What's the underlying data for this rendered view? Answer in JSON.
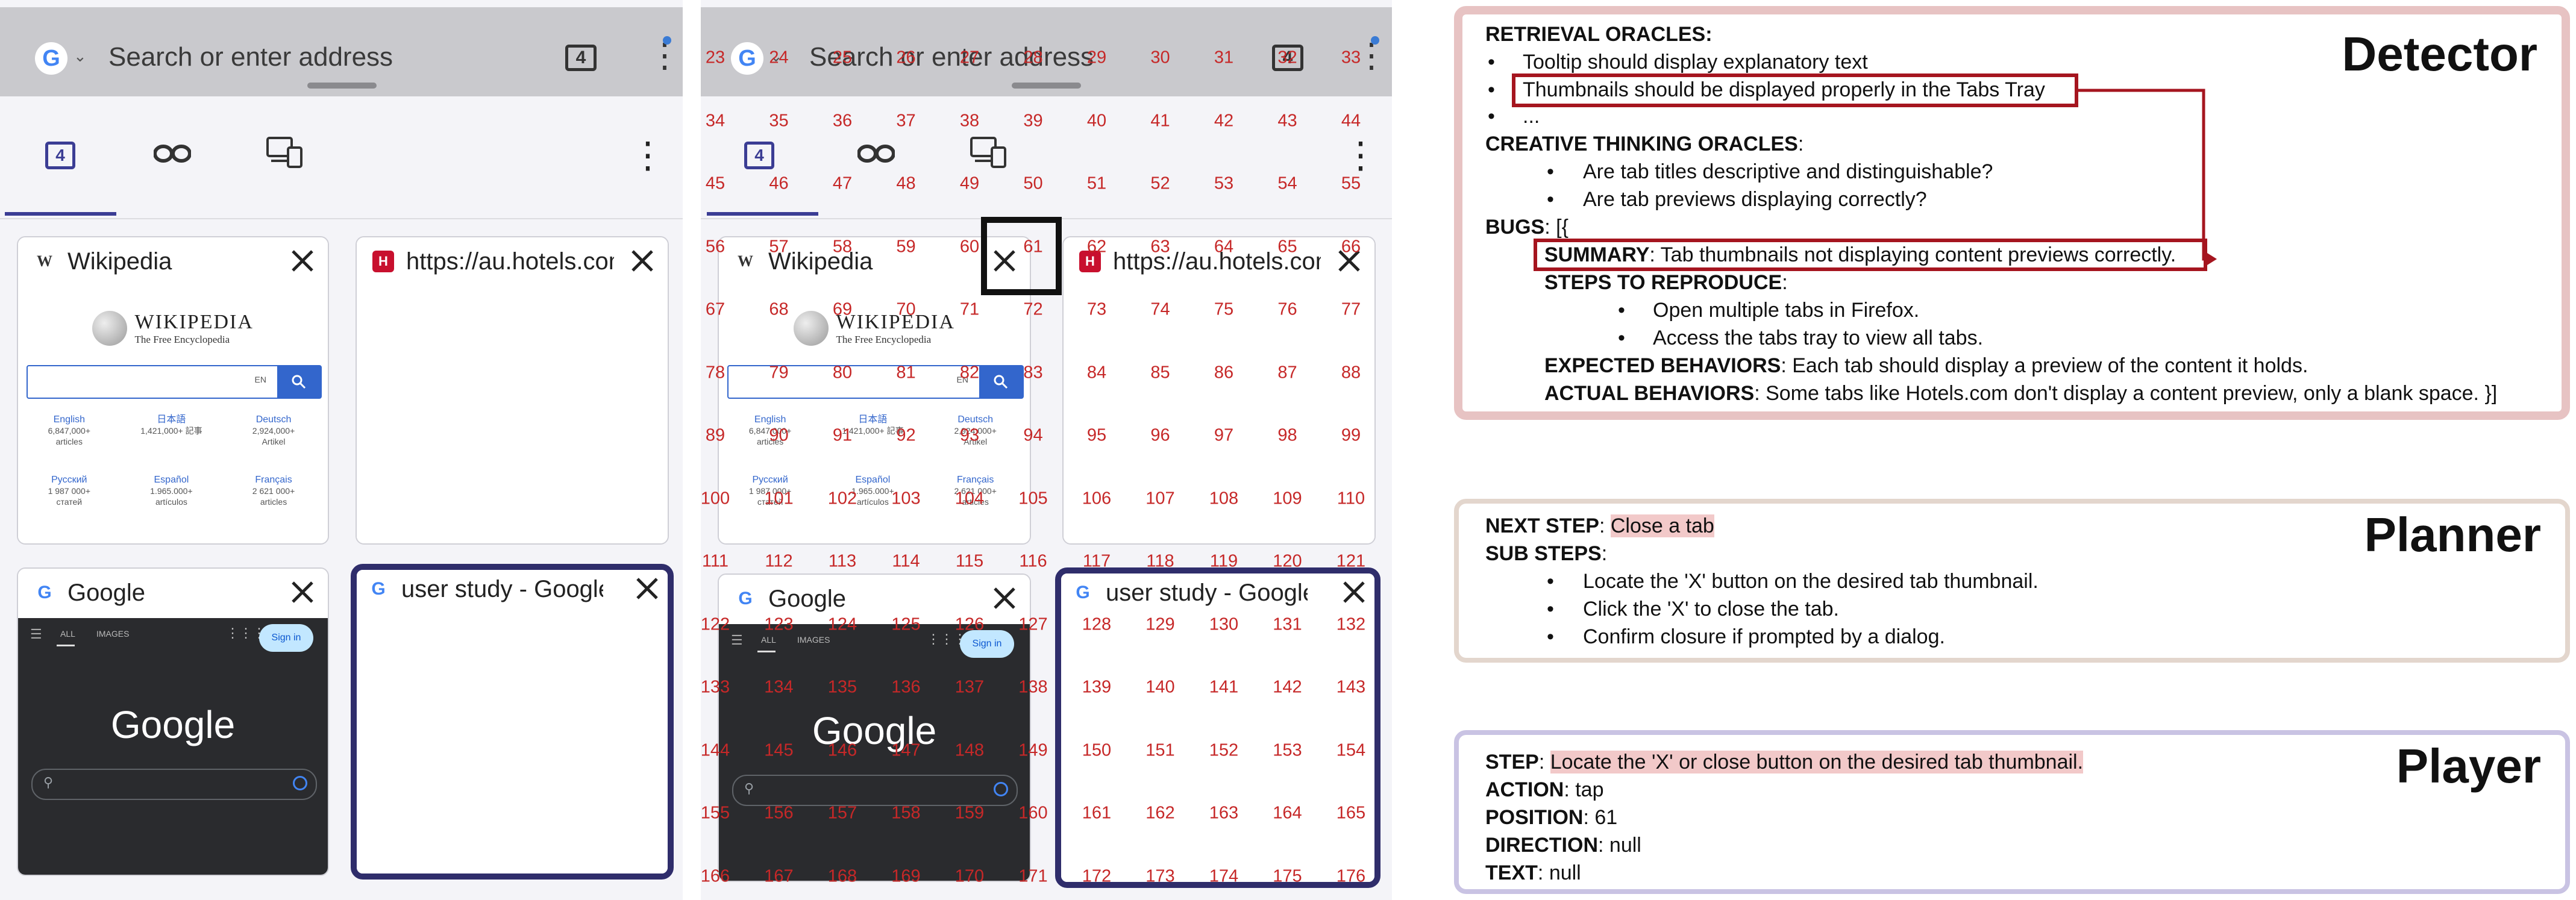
{
  "browser": {
    "address_placeholder": "Search or enter address",
    "tab_count": "4",
    "google_glyph": "G",
    "tabs": [
      {
        "title": "Wikipedia",
        "favicon": "W"
      },
      {
        "title": "https://au.hotels.com",
        "favicon": "H"
      },
      {
        "title": "Google",
        "favicon": "G"
      },
      {
        "title": "user study - Google S",
        "favicon": "G"
      }
    ],
    "wiki_thumb": {
      "brand": "WIKIPEDIA",
      "tagline": "The Free Encyclopedia",
      "lang_select": "EN",
      "languages": [
        {
          "name": "English",
          "count": "6,847,000+",
          "unit": "articles"
        },
        {
          "name": "日本語",
          "count": "1,421,000+ 記事",
          "unit": ""
        },
        {
          "name": "Deutsch",
          "count": "2,924,000+",
          "unit": "Artikel"
        },
        {
          "name": "Русский",
          "count": "1 987 000+",
          "unit": "статей"
        },
        {
          "name": "Español",
          "count": "1.965.000+",
          "unit": "artículos"
        },
        {
          "name": "Français",
          "count": "2 621 000+",
          "unit": "articles"
        }
      ]
    },
    "google_thumb": {
      "tab_all": "ALL",
      "tab_images": "IMAGES",
      "sign_in": "Sign in",
      "logo": "Google"
    }
  },
  "grid_labels": {
    "row_a": [
      "23",
      "24",
      "25",
      "26",
      "27",
      "28",
      "29",
      "30",
      "31",
      "32",
      "33"
    ],
    "row_b": [
      "34",
      "35",
      "36",
      "37",
      "38",
      "39",
      "40",
      "41",
      "42",
      "43",
      "44"
    ],
    "row_c": [
      "45",
      "46",
      "47",
      "48",
      "49",
      "50",
      "51",
      "52",
      "53",
      "54",
      "55"
    ],
    "row_d": [
      "56",
      "57",
      "58",
      "59",
      "60",
      "61",
      "62",
      "63",
      "64",
      "65",
      "66"
    ],
    "row_e": [
      "67",
      "68",
      "69",
      "70",
      "71",
      "72",
      "73",
      "74",
      "75",
      "76",
      "77"
    ],
    "row_f": [
      "78",
      "79",
      "80",
      "81",
      "82",
      "83",
      "84",
      "85",
      "86",
      "87",
      "88"
    ],
    "row_g": [
      "89",
      "90",
      "91",
      "92",
      "93",
      "94",
      "95",
      "96",
      "97",
      "98",
      "99"
    ],
    "row_h": [
      "100",
      "101",
      "102",
      "103",
      "104",
      "105",
      "106",
      "107",
      "108",
      "109",
      "110"
    ],
    "row_i": [
      "111",
      "112",
      "113",
      "114",
      "115",
      "116",
      "117",
      "118",
      "119",
      "120",
      "121"
    ],
    "row_j": [
      "122",
      "123",
      "124",
      "125",
      "126",
      "127",
      "128",
      "129",
      "130",
      "131",
      "132"
    ],
    "row_k": [
      "133",
      "134",
      "135",
      "136",
      "137",
      "138",
      "139",
      "140",
      "141",
      "142",
      "143"
    ],
    "row_l": [
      "144",
      "145",
      "146",
      "147",
      "148",
      "149",
      "150",
      "151",
      "152",
      "153",
      "154"
    ],
    "row_m": [
      "155",
      "156",
      "157",
      "158",
      "159",
      "160",
      "161",
      "162",
      "163",
      "164",
      "165"
    ],
    "row_n": [
      "166",
      "167",
      "168",
      "169",
      "170",
      "171",
      "172",
      "173",
      "174",
      "175",
      "176"
    ]
  },
  "detector": {
    "title": "Detector",
    "retrieval_heading": "RETRIEVAL ORACLES:",
    "retrieval_items": [
      "Tooltip should display explanatory text",
      "Thumbnails should be displayed properly in the Tabs Tray",
      "..."
    ],
    "creative_heading": "CREATIVE THINKING ORACLES",
    "creative_items": [
      "Are tab titles descriptive and distinguishable?",
      "Are tab previews displaying correctly?"
    ],
    "bugs_label": "BUGS",
    "bugs_open": ": [{",
    "summary_label": "SUMMARY",
    "summary_text": ": Tab thumbnails not displaying content previews correctly.",
    "steps_label": "STEPS TO REPRODUCE",
    "steps_items": [
      "Open multiple tabs in Firefox.",
      "Access the tabs tray to view all tabs."
    ],
    "expected_label": "EXPECTED BEHAVIORS",
    "expected_text": ": Each tab should display a preview of the content it holds.",
    "actual_label": "ACTUAL BEHAVIORS",
    "actual_text": ": Some tabs like Hotels.com don't display a content preview, only a blank space. }]"
  },
  "planner": {
    "title": "Planner",
    "next_step_label": "NEXT STEP",
    "next_step_value": "Close a tab",
    "sub_steps_label": "SUB STEPS",
    "sub_steps": [
      "Locate the 'X' button on the desired tab thumbnail.",
      "Click the 'X' to close the tab.",
      "Confirm closure if prompted by a dialog."
    ]
  },
  "player": {
    "title": "Player",
    "step_label": "STEP",
    "step_value": "Locate the 'X' or close button on the desired tab thumbnail.",
    "action_label": "ACTION",
    "action_value": "tap",
    "position_label": "POSITION",
    "position_value": "61",
    "direction_label": "DIRECTION",
    "direction_value": "null",
    "text_label": "TEXT",
    "text_value": "null"
  },
  "colors": {
    "accent": "#3b3d94",
    "selected_border": "#2f2d6b",
    "grid_number": "#c62828",
    "detector_border": "#e7c3c3",
    "planner_border": "#e3d6cd",
    "player_border": "#c9c3e3",
    "highlight": "#f2c9c9",
    "red_box": "#a5151f"
  }
}
